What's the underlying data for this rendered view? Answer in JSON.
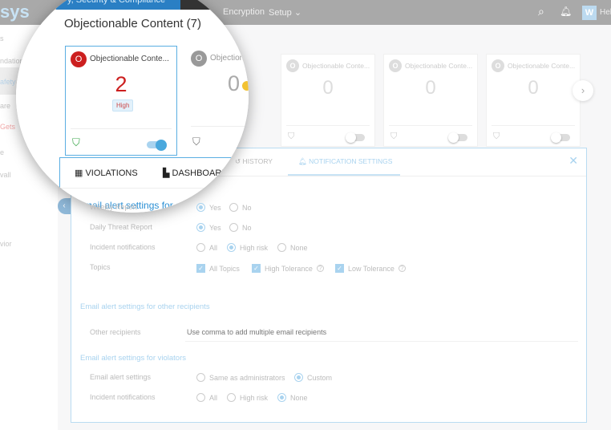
{
  "header": {
    "nav": [
      "Encryption",
      "Setup"
    ],
    "avatar": "W",
    "user_partial": "Hell",
    "product_tab_partial": "y, Security & Compliance",
    "logo_partial": "sys"
  },
  "sidebar": {
    "items": [
      "s",
      "ndations",
      "afety",
      "are",
      "Gets",
      "e",
      "vall",
      "vior"
    ]
  },
  "page_title": "Objectionable Content (7)",
  "cards": [
    {
      "badge": "O",
      "title": "Objectionable Conte...",
      "count": "2",
      "severity": "High",
      "enabled": true
    },
    {
      "badge": "O",
      "title": "Objectionable Conte...",
      "count": "0",
      "enabled": false
    },
    {
      "badge": "O",
      "title": "Objectionable Conte...",
      "count": "0",
      "enabled": false
    },
    {
      "badge": "O",
      "title": "Objectionable Conte...",
      "count": "0",
      "enabled": false
    },
    {
      "badge": "O",
      "title": "Objectionable Conte...",
      "count": "0",
      "enabled": false
    }
  ],
  "tabs": {
    "violations": "VIOLATIONS",
    "dashboard": "DASHBOARD",
    "history": "HISTORY",
    "notification": "NOTIFICATION SETTINGS"
  },
  "admin": {
    "heading": "Email alert settings for administrators",
    "rows": [
      {
        "label": "Weekly Report",
        "options": [
          "Yes",
          "No"
        ],
        "selected": "Yes"
      },
      {
        "label": "Daily Threat Report",
        "options": [
          "Yes",
          "No"
        ],
        "selected": "Yes"
      },
      {
        "label": "Incident notifications",
        "options": [
          "All",
          "High risk",
          "None"
        ],
        "selected": "High risk"
      },
      {
        "label": "Topics",
        "checks": [
          "All Topics",
          "High Tolerance",
          "Low Tolerance"
        ]
      }
    ]
  },
  "other": {
    "heading": "Email alert settings for other recipients",
    "label": "Other recipients",
    "placeholder": "Use comma to add multiple email recipients"
  },
  "violators": {
    "heading": "Email alert settings for violators",
    "rows": [
      {
        "label": "Email alert settings",
        "options": [
          "Same as administrators",
          "Custom"
        ],
        "selected": "Custom"
      },
      {
        "label": "Incident notifications",
        "options": [
          "All",
          "High risk",
          "None"
        ],
        "selected": "None"
      }
    ]
  },
  "colors": {
    "accent": "#4aa8dd",
    "danger": "#cc1f1f",
    "header": "#a9a9a9"
  }
}
